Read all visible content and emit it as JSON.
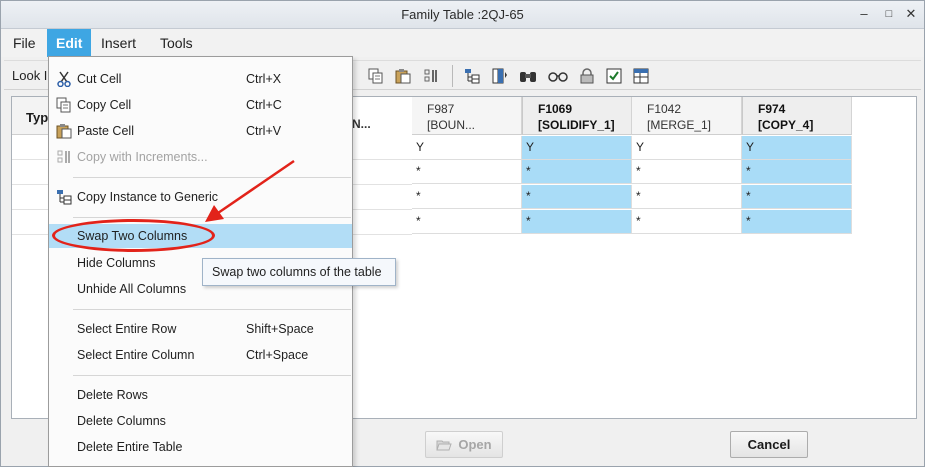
{
  "window": {
    "title": "Family Table :2QJ-65",
    "minimize_glyph": "–",
    "maximize_glyph": "□",
    "close_glyph": "✕"
  },
  "menubar": {
    "items": [
      {
        "label": "File"
      },
      {
        "label": "Edit",
        "active": true
      },
      {
        "label": "Insert"
      },
      {
        "label": "Tools"
      }
    ]
  },
  "toolbar": {
    "look_in_label": "Look I",
    "icons": [
      "copy-cells-icon",
      "paste-icon",
      "increment-icon",
      "instance-tree-icon",
      "insert-column-icon",
      "binoculars-icon",
      "glasses-icon",
      "lock-icon",
      "verify-icon",
      "table-icon"
    ]
  },
  "table": {
    "type_header": "Typ",
    "partial_header": "N...",
    "columns": [
      {
        "id": "F987",
        "name": "[BOUN...",
        "highlighted": false
      },
      {
        "id": "F1069",
        "name": "[SOLIDIFY_1]",
        "highlighted": true
      },
      {
        "id": "F1042",
        "name": "[MERGE_1]",
        "highlighted": false
      },
      {
        "id": "F974",
        "name": "[COPY_4]",
        "highlighted": true
      }
    ],
    "rows": [
      [
        "Y",
        "Y",
        "Y",
        "Y"
      ],
      [
        "*",
        "*",
        "*",
        "*"
      ],
      [
        "*",
        "*",
        "*",
        "*"
      ],
      [
        "*",
        "*",
        "*",
        "*"
      ]
    ]
  },
  "edit_menu": {
    "groups": [
      [
        {
          "label": "Cut Cell",
          "shortcut": "Ctrl+X",
          "icon": "scissors-icon"
        },
        {
          "label": "Copy Cell",
          "shortcut": "Ctrl+C",
          "icon": "copy-icon"
        },
        {
          "label": "Paste Cell",
          "shortcut": "Ctrl+V",
          "icon": "paste-icon"
        },
        {
          "label": "Copy with Increments...",
          "shortcut": "",
          "icon": "increment-icon",
          "disabled": true
        }
      ],
      [
        {
          "label": "Copy Instance to Generic",
          "shortcut": "",
          "icon": "instance-tree-icon"
        }
      ],
      [
        {
          "label": "Swap Two Columns",
          "shortcut": "",
          "hover": true
        },
        {
          "label": "Hide Columns",
          "shortcut": ""
        },
        {
          "label": "Unhide All Columns",
          "shortcut": ""
        }
      ],
      [
        {
          "label": "Select Entire Row",
          "shortcut": "Shift+Space"
        },
        {
          "label": "Select Entire Column",
          "shortcut": "Ctrl+Space"
        }
      ],
      [
        {
          "label": "Delete Rows",
          "shortcut": ""
        },
        {
          "label": "Delete Columns",
          "shortcut": ""
        },
        {
          "label": "Delete Entire Table",
          "shortcut": ""
        }
      ]
    ]
  },
  "tooltip": {
    "text": "Swap two columns of the table"
  },
  "buttons": {
    "open_label": "Open",
    "cancel_label": "Cancel"
  },
  "colors": {
    "menu_active": "#3ea6e3",
    "column_highlight": "#a9dcf7",
    "menu_hover": "#b2ddf6",
    "annotation_red": "#e2231a"
  }
}
